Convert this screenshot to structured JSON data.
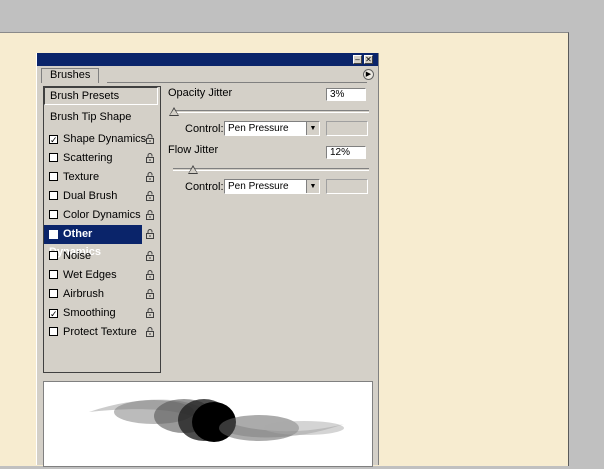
{
  "panel": {
    "tab_label": "Brushes",
    "minimize_icon": "minimize-icon",
    "close_icon": "close-icon",
    "menu_icon": "panel-menu-arrow-icon"
  },
  "left_list": {
    "presets_label": "Brush Presets",
    "tip_shape_label": "Brush Tip Shape",
    "items": [
      {
        "label": "Shape Dynamics",
        "checked": true,
        "mark": "✓"
      },
      {
        "label": "Scattering",
        "checked": false,
        "mark": ""
      },
      {
        "label": "Texture",
        "checked": false,
        "mark": ""
      },
      {
        "label": "Dual Brush",
        "checked": false,
        "mark": ""
      },
      {
        "label": "Color Dynamics",
        "checked": false,
        "mark": ""
      },
      {
        "label": "Other Dynamics",
        "checked": true,
        "mark": "✓",
        "selected": true
      },
      {
        "label": "Noise",
        "checked": false,
        "mark": ""
      },
      {
        "label": "Wet Edges",
        "checked": false,
        "mark": ""
      },
      {
        "label": "Airbrush",
        "checked": false,
        "mark": ""
      },
      {
        "label": "Smoothing",
        "checked": true,
        "mark": "✓"
      },
      {
        "label": "Protect Texture",
        "checked": false,
        "mark": ""
      }
    ],
    "lock_icon": "lock-icon"
  },
  "opacity": {
    "label": "Opacity Jitter",
    "value": "3%",
    "control_label": "Control:",
    "control_value": "Pen Pressure"
  },
  "flow": {
    "label": "Flow Jitter",
    "value": "12%",
    "control_label": "Control:",
    "control_value": "Pen Pressure"
  },
  "colors": {
    "titlebar": "#0a246a",
    "panel_bg": "#d4d0c8",
    "canvas_bg": "#f7ecd0",
    "selected_bg": "#0a246a"
  }
}
